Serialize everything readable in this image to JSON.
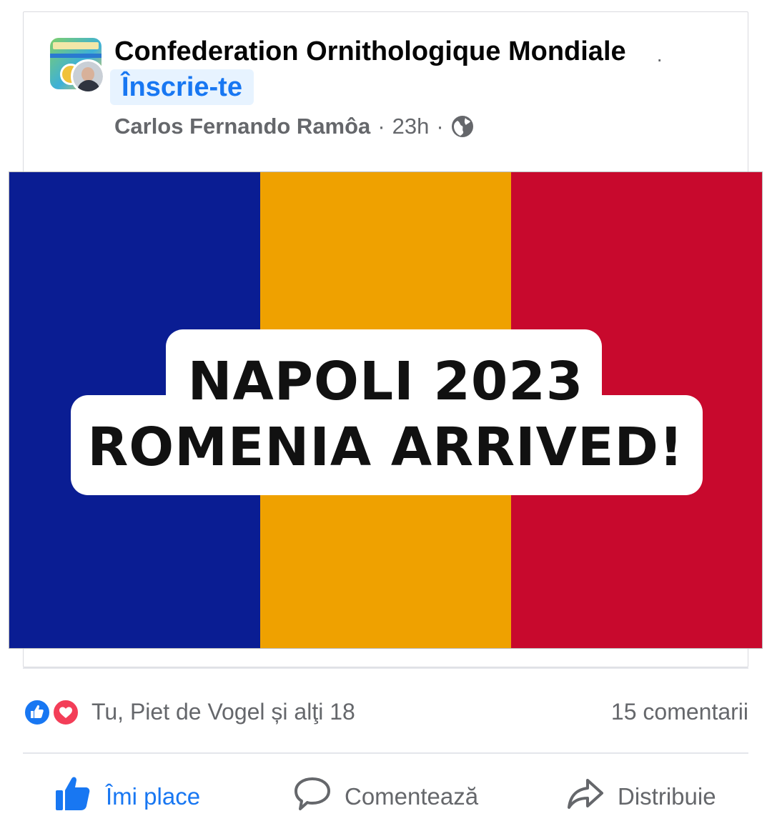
{
  "post": {
    "group_name": "Confederation Ornithologique Mondiale",
    "dot": "·",
    "join_label": "Înscrie-te",
    "author": "Carlos Fernando Ramôa",
    "separator": "·",
    "time": "23h",
    "audience_icon": "globe-icon"
  },
  "image": {
    "flag_colors": [
      "#0a1d93",
      "#efa100",
      "#c8092d"
    ],
    "line1": "NAPOLI 2023",
    "line2": "ROMENIA ARRIVED!"
  },
  "reactions": {
    "icons": [
      "like-icon",
      "love-icon"
    ],
    "summary": "Tu, Piet de Vogel și alţi 18",
    "comments": "15 comentarii"
  },
  "actions": {
    "like": "Îmi place",
    "comment": "Comentează",
    "share": "Distribuie"
  },
  "colors": {
    "accent": "#1877f2",
    "muted": "#65676b",
    "love": "#f33e58"
  }
}
